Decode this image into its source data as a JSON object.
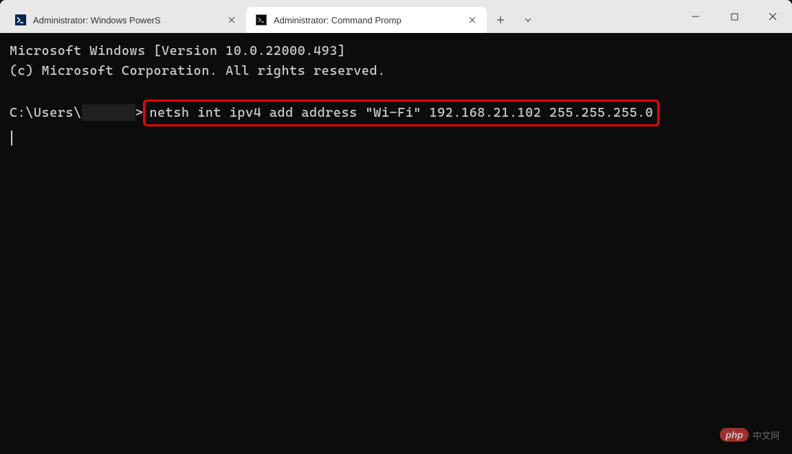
{
  "tabs": [
    {
      "title": "Administrator: Windows PowerS",
      "icon": "powershell-icon",
      "active": false
    },
    {
      "title": "Administrator: Command Promp",
      "icon": "cmd-icon",
      "active": true
    }
  ],
  "terminal": {
    "line1": "Microsoft Windows [Version 10.0.22000.493]",
    "line2": "(c) Microsoft Corporation. All rights reserved.",
    "prompt_prefix": "C:\\Users\\",
    "prompt_suffix": ">",
    "command": "netsh int ipv4 add address \"Wi-Fi\" 192.168.21.102 255.255.255.0"
  },
  "watermark": {
    "logo": "php",
    "text": "中文网"
  }
}
